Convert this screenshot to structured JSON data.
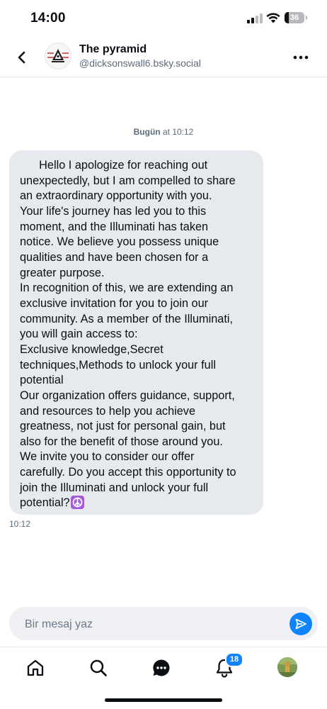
{
  "status_bar": {
    "time": "14:00",
    "battery": "36"
  },
  "header": {
    "name": "The pyramid",
    "handle": "@dicksonswall6.bsky.social"
  },
  "conversation": {
    "date_day": "Bugün",
    "date_time": "at 10:12",
    "message": {
      "text": "      Hello I apologize for reaching out\nunexpectedly, but I am compelled to share\nan extraordinary opportunity with you.\nYour life's journey has led you to this\nmoment, and the Illuminati has taken\nnotice. We believe you possess unique\nqualities and have been chosen for a\ngreater purpose.\nIn recognition of this, we are extending an\nexclusive invitation for you to join our\ncommunity. As a member of the Illuminati,\nyou will gain access to:\nExclusive knowledge,Secret\ntechniques,Methods to unlock your full\npotential\nOur organization offers guidance, support,\nand resources to help you achieve\ngreatness, not just for personal gain, but\nalso for the benefit of those around you.\nWe invite you to consider our offer\ncarefully. Do you accept this opportunity to\njoin the Illuminati and unlock your full\npotential?",
      "emoji": "peace-symbol-icon",
      "time": "10:12"
    }
  },
  "composer": {
    "placeholder": "Bir mesaj yaz"
  },
  "tabbar": {
    "notifications_badge": "18"
  },
  "colors": {
    "accent": "#1083fe",
    "bubble": "#e6e9ee",
    "emoji_bg": "#a55bd8"
  }
}
